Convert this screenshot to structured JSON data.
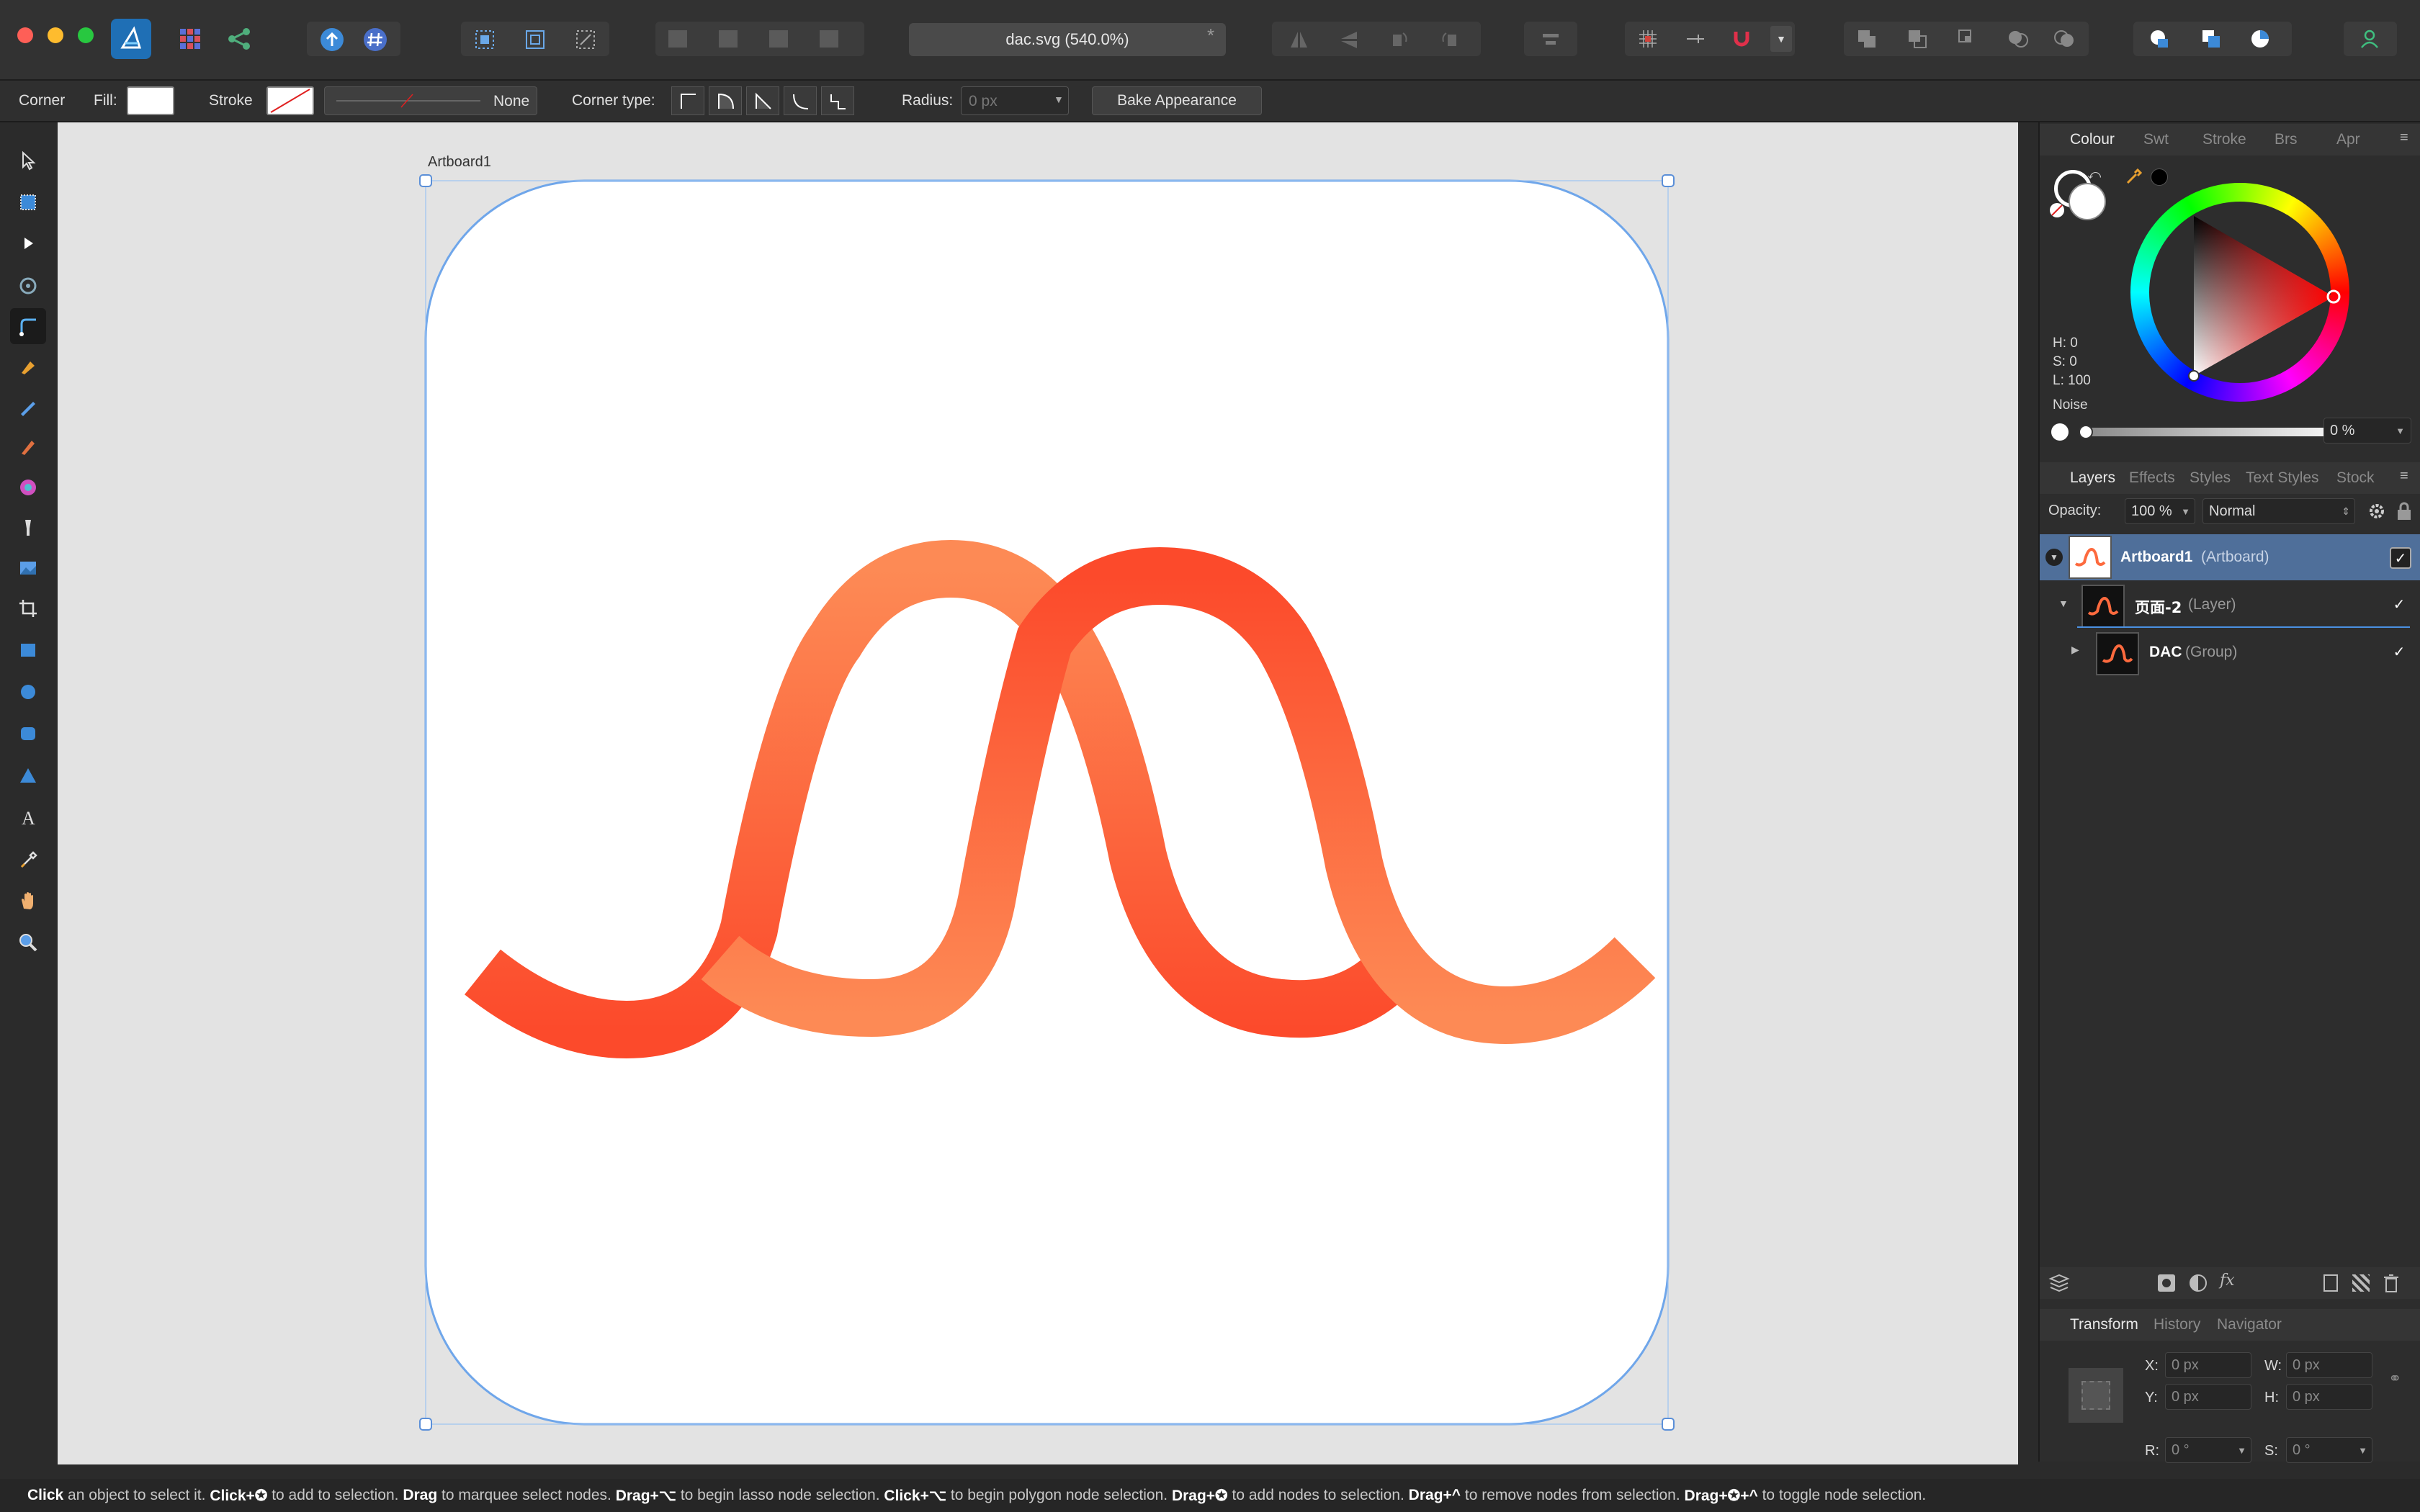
{
  "window": {
    "doc_title": "dac.svg (540.0%)",
    "modified_mark": "*"
  },
  "context_bar": {
    "tool_name": "Corner",
    "fill_label": "Fill:",
    "stroke_label": "Stroke",
    "stroke_value": "None",
    "corner_type_label": "Corner type:",
    "radius_label": "Radius:",
    "radius_value": "0 px",
    "bake_button": "Bake Appearance"
  },
  "artboard": {
    "name": "Artboard1"
  },
  "colour_panel": {
    "tabs": [
      "Colour",
      "Swt",
      "Stroke",
      "Brs",
      "Apr"
    ],
    "h": "H: 0",
    "s": "S: 0",
    "l": "L: 100",
    "noise_label": "Noise",
    "noise_value": "0 %"
  },
  "layers_panel": {
    "tabs": [
      "Layers",
      "Effects",
      "Styles",
      "Text Styles",
      "Stock"
    ],
    "opacity_label": "Opacity:",
    "opacity_value": "100 %",
    "blend_mode": "Normal",
    "rows": [
      {
        "name": "Artboard1",
        "type": "(Artboard)"
      },
      {
        "name": "页面-2",
        "type": "(Layer)"
      },
      {
        "name": "DAC",
        "type": "(Group)"
      }
    ]
  },
  "transform_panel": {
    "tabs": [
      "Transform",
      "History",
      "Navigator"
    ],
    "x_label": "X:",
    "x_value": "0 px",
    "y_label": "Y:",
    "y_value": "0 px",
    "w_label": "W:",
    "w_value": "0 px",
    "h_label": "H:",
    "h_value": "0 px",
    "r_label": "R:",
    "r_value": "0 °",
    "s_label": "S:",
    "s_value": "0 °"
  },
  "status_bar": {
    "parts": [
      {
        "bold": "Click",
        "text": " an object to select it. "
      },
      {
        "bold": "Click+✪",
        "text": " to add to selection. "
      },
      {
        "bold": "Drag",
        "text": " to marquee select nodes. "
      },
      {
        "bold": "Drag+⌥",
        "text": " to begin lasso node selection. "
      },
      {
        "bold": "Click+⌥",
        "text": " to begin polygon node selection. "
      },
      {
        "bold": "Drag+✪",
        "text": " to add nodes to selection. "
      },
      {
        "bold": "Drag+^",
        "text": " to remove nodes from selection. "
      },
      {
        "bold": "Drag+✪+^",
        "text": " to toggle node selection."
      }
    ]
  },
  "colors": {
    "accent": "#4a90e2",
    "logo_orange_dark": "#fc4a2b",
    "logo_orange_light": "#fd8a55",
    "selection_row": "#4f6f9a"
  }
}
